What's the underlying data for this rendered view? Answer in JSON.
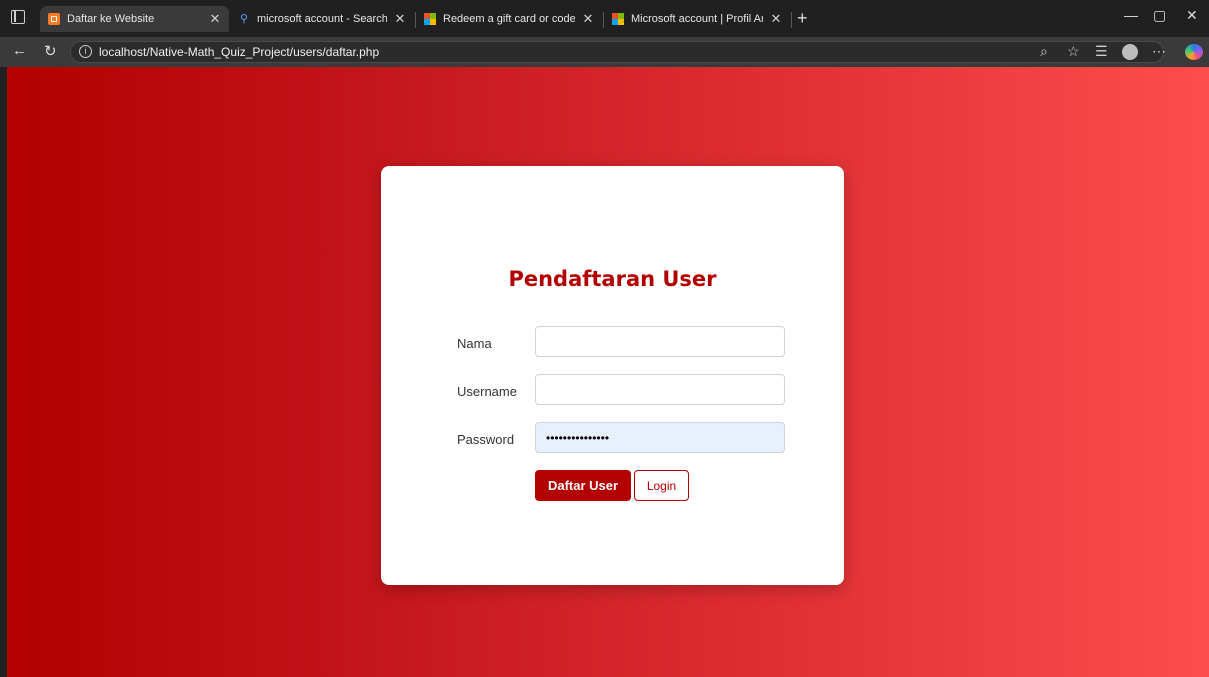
{
  "browser": {
    "tabs": [
      {
        "title": "Daftar ke Website",
        "favicon": "xampp-icon",
        "active": true
      },
      {
        "title": "microsoft account - Search",
        "favicon": "search-icon",
        "active": false
      },
      {
        "title": "Redeem a gift card or code to yo",
        "favicon": "microsoft-icon",
        "active": false
      },
      {
        "title": "Microsoft account | Profil Anda",
        "favicon": "microsoft-icon",
        "active": false
      }
    ],
    "url": "localhost/Native-Math_Quiz_Project/users/daftar.php"
  },
  "page": {
    "background_colors": [
      "#b30000",
      "#ff4d4d"
    ],
    "accent": "#b30000",
    "title": "Pendaftaran User",
    "fields": [
      {
        "label": "Nama",
        "value": ""
      },
      {
        "label": "Username",
        "value": ""
      },
      {
        "label": "Password",
        "value": "•••••••••••••••"
      }
    ],
    "submit_label": "Daftar User",
    "login_label": "Login"
  }
}
